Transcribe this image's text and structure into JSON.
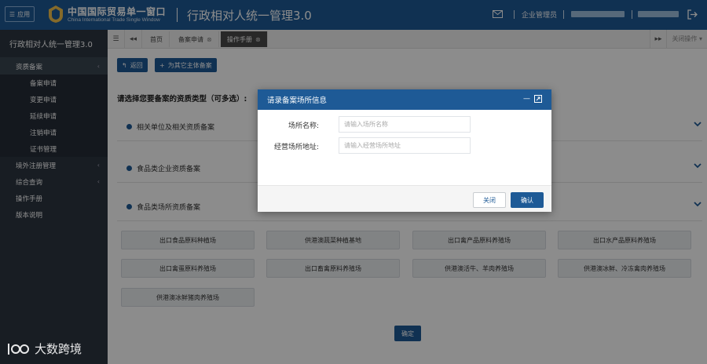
{
  "header": {
    "app_button": "应用",
    "brand_cn": "中国国际贸易单一窗口",
    "brand_en": "China International Trade Single Window",
    "system_title": "行政相对人统一管理3.0",
    "user_role": "企业管理员"
  },
  "sidebar": {
    "title": "行政相对人统一管理3.0",
    "groups": [
      {
        "label": "资质备案",
        "expanded": true,
        "children": [
          "备案申请",
          "变更申请",
          "延续申请",
          "注销申请",
          "证书管理"
        ]
      },
      {
        "label": "境外注册管理"
      },
      {
        "label": "综合查询"
      },
      {
        "label": "操作手册"
      },
      {
        "label": "版本说明"
      }
    ]
  },
  "tabs": {
    "items": [
      {
        "label": "首页"
      },
      {
        "label": "备案申请"
      },
      {
        "label": "操作手册"
      }
    ],
    "close_ops": "关闭操作"
  },
  "main": {
    "back_label": "返回",
    "other_subject_label": "为其它主体备案",
    "prompt": "请选择您要备案的资质类型（可多选）:",
    "categories": [
      "相关单位及相关资质备案",
      "食品类企业资质备案",
      "食品类场所资质备案"
    ],
    "options": [
      "出口食品原料种植场",
      "供港澳蔬菜种植基地",
      "出口禽产品原料养殖场",
      "出口水产品原料养殖场",
      "出口禽蛋原料养殖场",
      "出口畜禽原料养殖场",
      "供港澳活牛、羊肉养殖场",
      "供港澳冰鲜、冷冻禽肉养殖场",
      "供港澳冰鲜猪肉养殖场"
    ],
    "confirm_label": "确定"
  },
  "modal": {
    "title": "请录备案场所信息",
    "fields": [
      {
        "label": "场所名称:",
        "value": "",
        "placeholder": "请输入场所名称"
      },
      {
        "label": "经营场所地址:",
        "value": "",
        "placeholder": "请输入经营场所地址"
      }
    ],
    "close_label": "关闭",
    "ok_label": "确认"
  },
  "watermark": {
    "text": "大数跨境"
  },
  "colors": {
    "primary": "#1e5a96",
    "sidebar": "#2c3540"
  }
}
